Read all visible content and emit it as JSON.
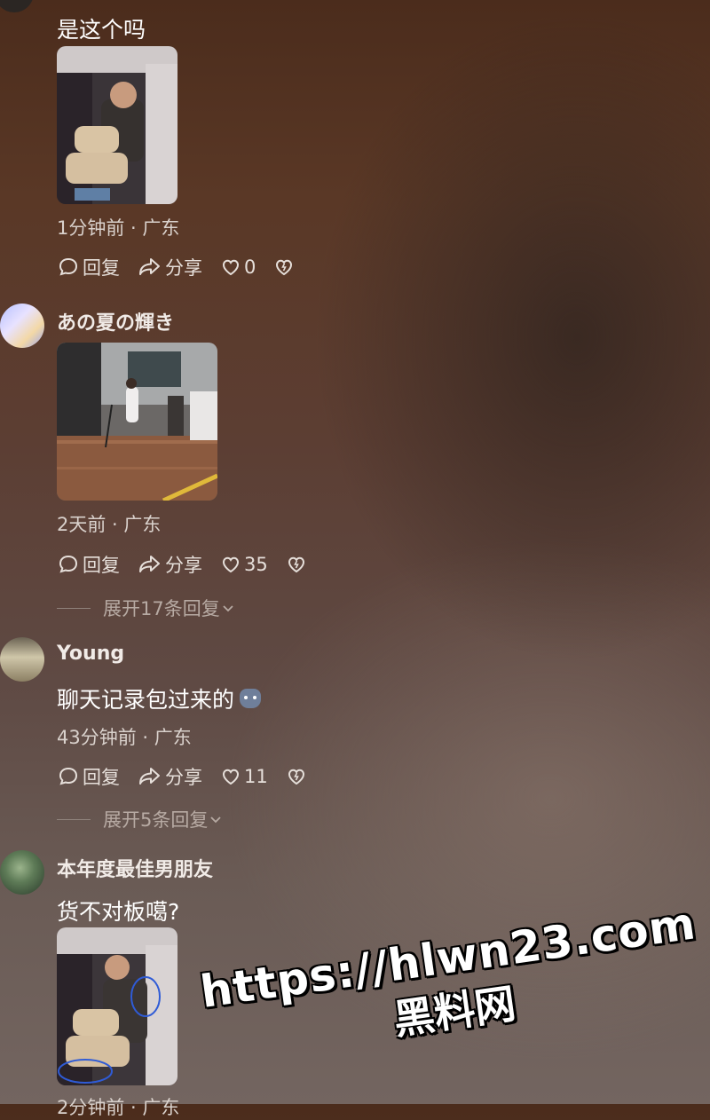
{
  "comments": [
    {
      "username": "",
      "text": "是这个吗",
      "meta": "1分钟前 · 广东",
      "reply_label": "回复",
      "share_label": "分享",
      "like_count": "0"
    },
    {
      "username": "あの夏の輝き",
      "text": "",
      "meta": "2天前 · 广东",
      "reply_label": "回复",
      "share_label": "分享",
      "like_count": "35",
      "expand_label": "展开17条回复"
    },
    {
      "username": "Young",
      "text": "聊天记录包过来的",
      "emoji": "cat-emoji",
      "meta": "43分钟前 · 广东",
      "reply_label": "回复",
      "share_label": "分享",
      "like_count": "11",
      "expand_label": "展开5条回复"
    },
    {
      "username": "本年度最佳男朋友",
      "text": "货不对板噶?",
      "meta": "2分钟前 · 广东"
    }
  ],
  "watermark": {
    "url": "https://hlwn23.com",
    "site_name": "黑料网"
  },
  "icons": [
    "reply-icon",
    "share-icon",
    "heart-icon",
    "dislike-icon",
    "chevron-down-icon"
  ]
}
